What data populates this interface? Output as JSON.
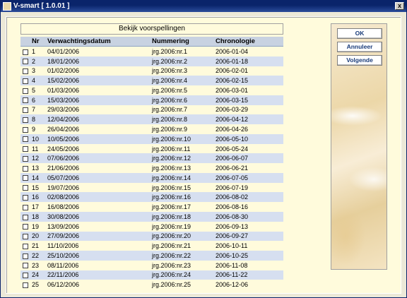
{
  "window": {
    "title": "V-smart [ 1.0.01 ]",
    "close_label": "x"
  },
  "header": {
    "title": "Bekijk voorspellingen"
  },
  "table": {
    "columns": [
      "",
      "Nr",
      "Verwachtingsdatum",
      "Nummering",
      "Chronologie"
    ],
    "rows": [
      {
        "nr": "1",
        "date": "04/01/2006",
        "num": "jrg.2006:nr.1",
        "chron": "2006-01-04"
      },
      {
        "nr": "2",
        "date": "18/01/2006",
        "num": "jrg.2006:nr.2",
        "chron": "2006-01-18"
      },
      {
        "nr": "3",
        "date": "01/02/2006",
        "num": "jrg.2006:nr.3",
        "chron": "2006-02-01"
      },
      {
        "nr": "4",
        "date": "15/02/2006",
        "num": "jrg.2006:nr.4",
        "chron": "2006-02-15"
      },
      {
        "nr": "5",
        "date": "01/03/2006",
        "num": "jrg.2006:nr.5",
        "chron": "2006-03-01"
      },
      {
        "nr": "6",
        "date": "15/03/2006",
        "num": "jrg.2006:nr.6",
        "chron": "2006-03-15"
      },
      {
        "nr": "7",
        "date": "29/03/2006",
        "num": "jrg.2006:nr.7",
        "chron": "2006-03-29"
      },
      {
        "nr": "8",
        "date": "12/04/2006",
        "num": "jrg.2006:nr.8",
        "chron": "2006-04-12"
      },
      {
        "nr": "9",
        "date": "26/04/2006",
        "num": "jrg.2006:nr.9",
        "chron": "2006-04-26"
      },
      {
        "nr": "10",
        "date": "10/05/2006",
        "num": "jrg.2006:nr.10",
        "chron": "2006-05-10"
      },
      {
        "nr": "11",
        "date": "24/05/2006",
        "num": "jrg.2006:nr.11",
        "chron": "2006-05-24"
      },
      {
        "nr": "12",
        "date": "07/06/2006",
        "num": "jrg.2006:nr.12",
        "chron": "2006-06-07"
      },
      {
        "nr": "13",
        "date": "21/06/2006",
        "num": "jrg.2006:nr.13",
        "chron": "2006-06-21"
      },
      {
        "nr": "14",
        "date": "05/07/2006",
        "num": "jrg.2006:nr.14",
        "chron": "2006-07-05"
      },
      {
        "nr": "15",
        "date": "19/07/2006",
        "num": "jrg.2006:nr.15",
        "chron": "2006-07-19"
      },
      {
        "nr": "16",
        "date": "02/08/2006",
        "num": "jrg.2006:nr.16",
        "chron": "2006-08-02"
      },
      {
        "nr": "17",
        "date": "16/08/2006",
        "num": "jrg.2006:nr.17",
        "chron": "2006-08-16"
      },
      {
        "nr": "18",
        "date": "30/08/2006",
        "num": "jrg.2006:nr.18",
        "chron": "2006-08-30"
      },
      {
        "nr": "19",
        "date": "13/09/2006",
        "num": "jrg.2006:nr.19",
        "chron": "2006-09-13"
      },
      {
        "nr": "20",
        "date": "27/09/2006",
        "num": "jrg.2006:nr.20",
        "chron": "2006-09-27"
      },
      {
        "nr": "21",
        "date": "11/10/2006",
        "num": "jrg.2006:nr.21",
        "chron": "2006-10-11"
      },
      {
        "nr": "22",
        "date": "25/10/2006",
        "num": "jrg.2006:nr.22",
        "chron": "2006-10-25"
      },
      {
        "nr": "23",
        "date": "08/11/2006",
        "num": "jrg.2006:nr.23",
        "chron": "2006-11-08"
      },
      {
        "nr": "24",
        "date": "22/11/2006",
        "num": "jrg.2006:nr.24",
        "chron": "2006-11-22"
      },
      {
        "nr": "25",
        "date": "06/12/2006",
        "num": "jrg.2006:nr.25",
        "chron": "2006-12-06"
      }
    ]
  },
  "buttons": {
    "ok": "OK",
    "cancel": "Annuleer",
    "next": "Volgende"
  },
  "colors": {
    "title_bar": "#0a246a",
    "row_alt": "#d6dff0",
    "panel_bg": "#fffbdc",
    "button_text": "#1a3c7a"
  }
}
